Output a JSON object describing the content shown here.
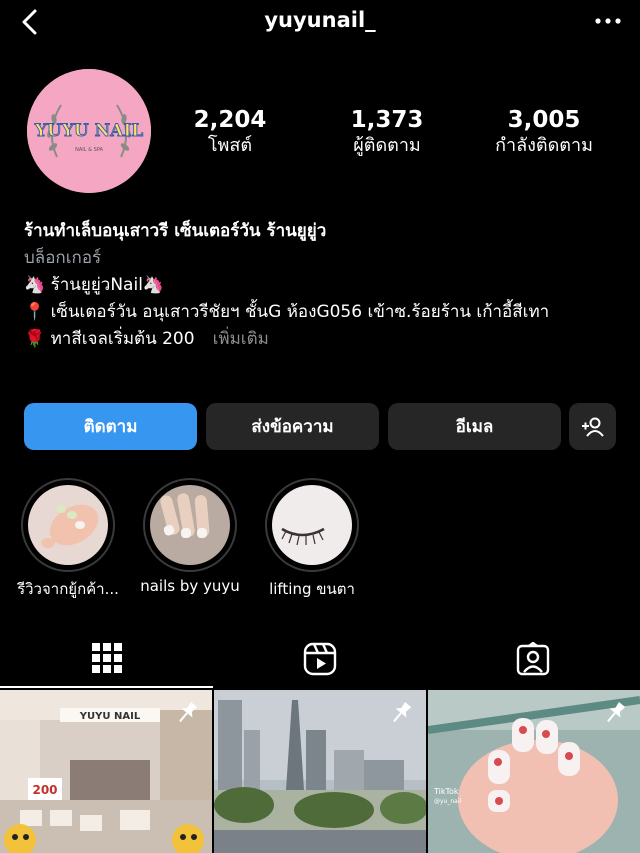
{
  "header": {
    "username": "yuyunail_"
  },
  "profile": {
    "avatar_text": "YUYU NAIL",
    "avatar_sub": "NAIL & SPA",
    "stats": {
      "posts": {
        "value": "2,204",
        "label": "โพสต์"
      },
      "followers": {
        "value": "1,373",
        "label": "ผู้ติดตาม"
      },
      "following": {
        "value": "3,005",
        "label": "กำลังติดตาม"
      }
    },
    "bio": {
      "name": "ร้านทำเล็บอนุเสาวรี เซ็นเตอร์วัน ร้านยูยู่ว",
      "category": "บล็อกเกอร์",
      "line1": "🦄 ร้านยูยู่วNail🦄",
      "line2": "📍 เซ็นเตอร์วัน อนุเสาวรีชัยฯ ชั้นG ห้องG056 เข้าซ.ร้อยร้าน เก้าอี้สีเทา",
      "line3": "🌹 ทาสีเจลเริ่มต้น 200",
      "more": "เพิ่มเติม"
    }
  },
  "actions": {
    "follow": "ติดตาม",
    "message": "ส่งข้อความ",
    "email": "อีเมล"
  },
  "highlights": [
    {
      "label": "รีวิวจากยู้กค้า..."
    },
    {
      "label": "nails by yuyu"
    },
    {
      "label": "lifting ขนตา"
    }
  ],
  "posts": [
    {
      "overlay": "YUYU NAIL",
      "price": "200"
    },
    {
      "overlay": ""
    },
    {
      "overlay": "TikTok",
      "handle": "@yu_nail"
    }
  ],
  "colors": {
    "accent": "#3797f0",
    "button": "#262626",
    "background": "#000000"
  },
  "icons": [
    "back-arrow-icon",
    "more-dots-icon",
    "add-user-icon",
    "grid-icon",
    "reels-icon",
    "tagged-icon",
    "pin-icon"
  ]
}
